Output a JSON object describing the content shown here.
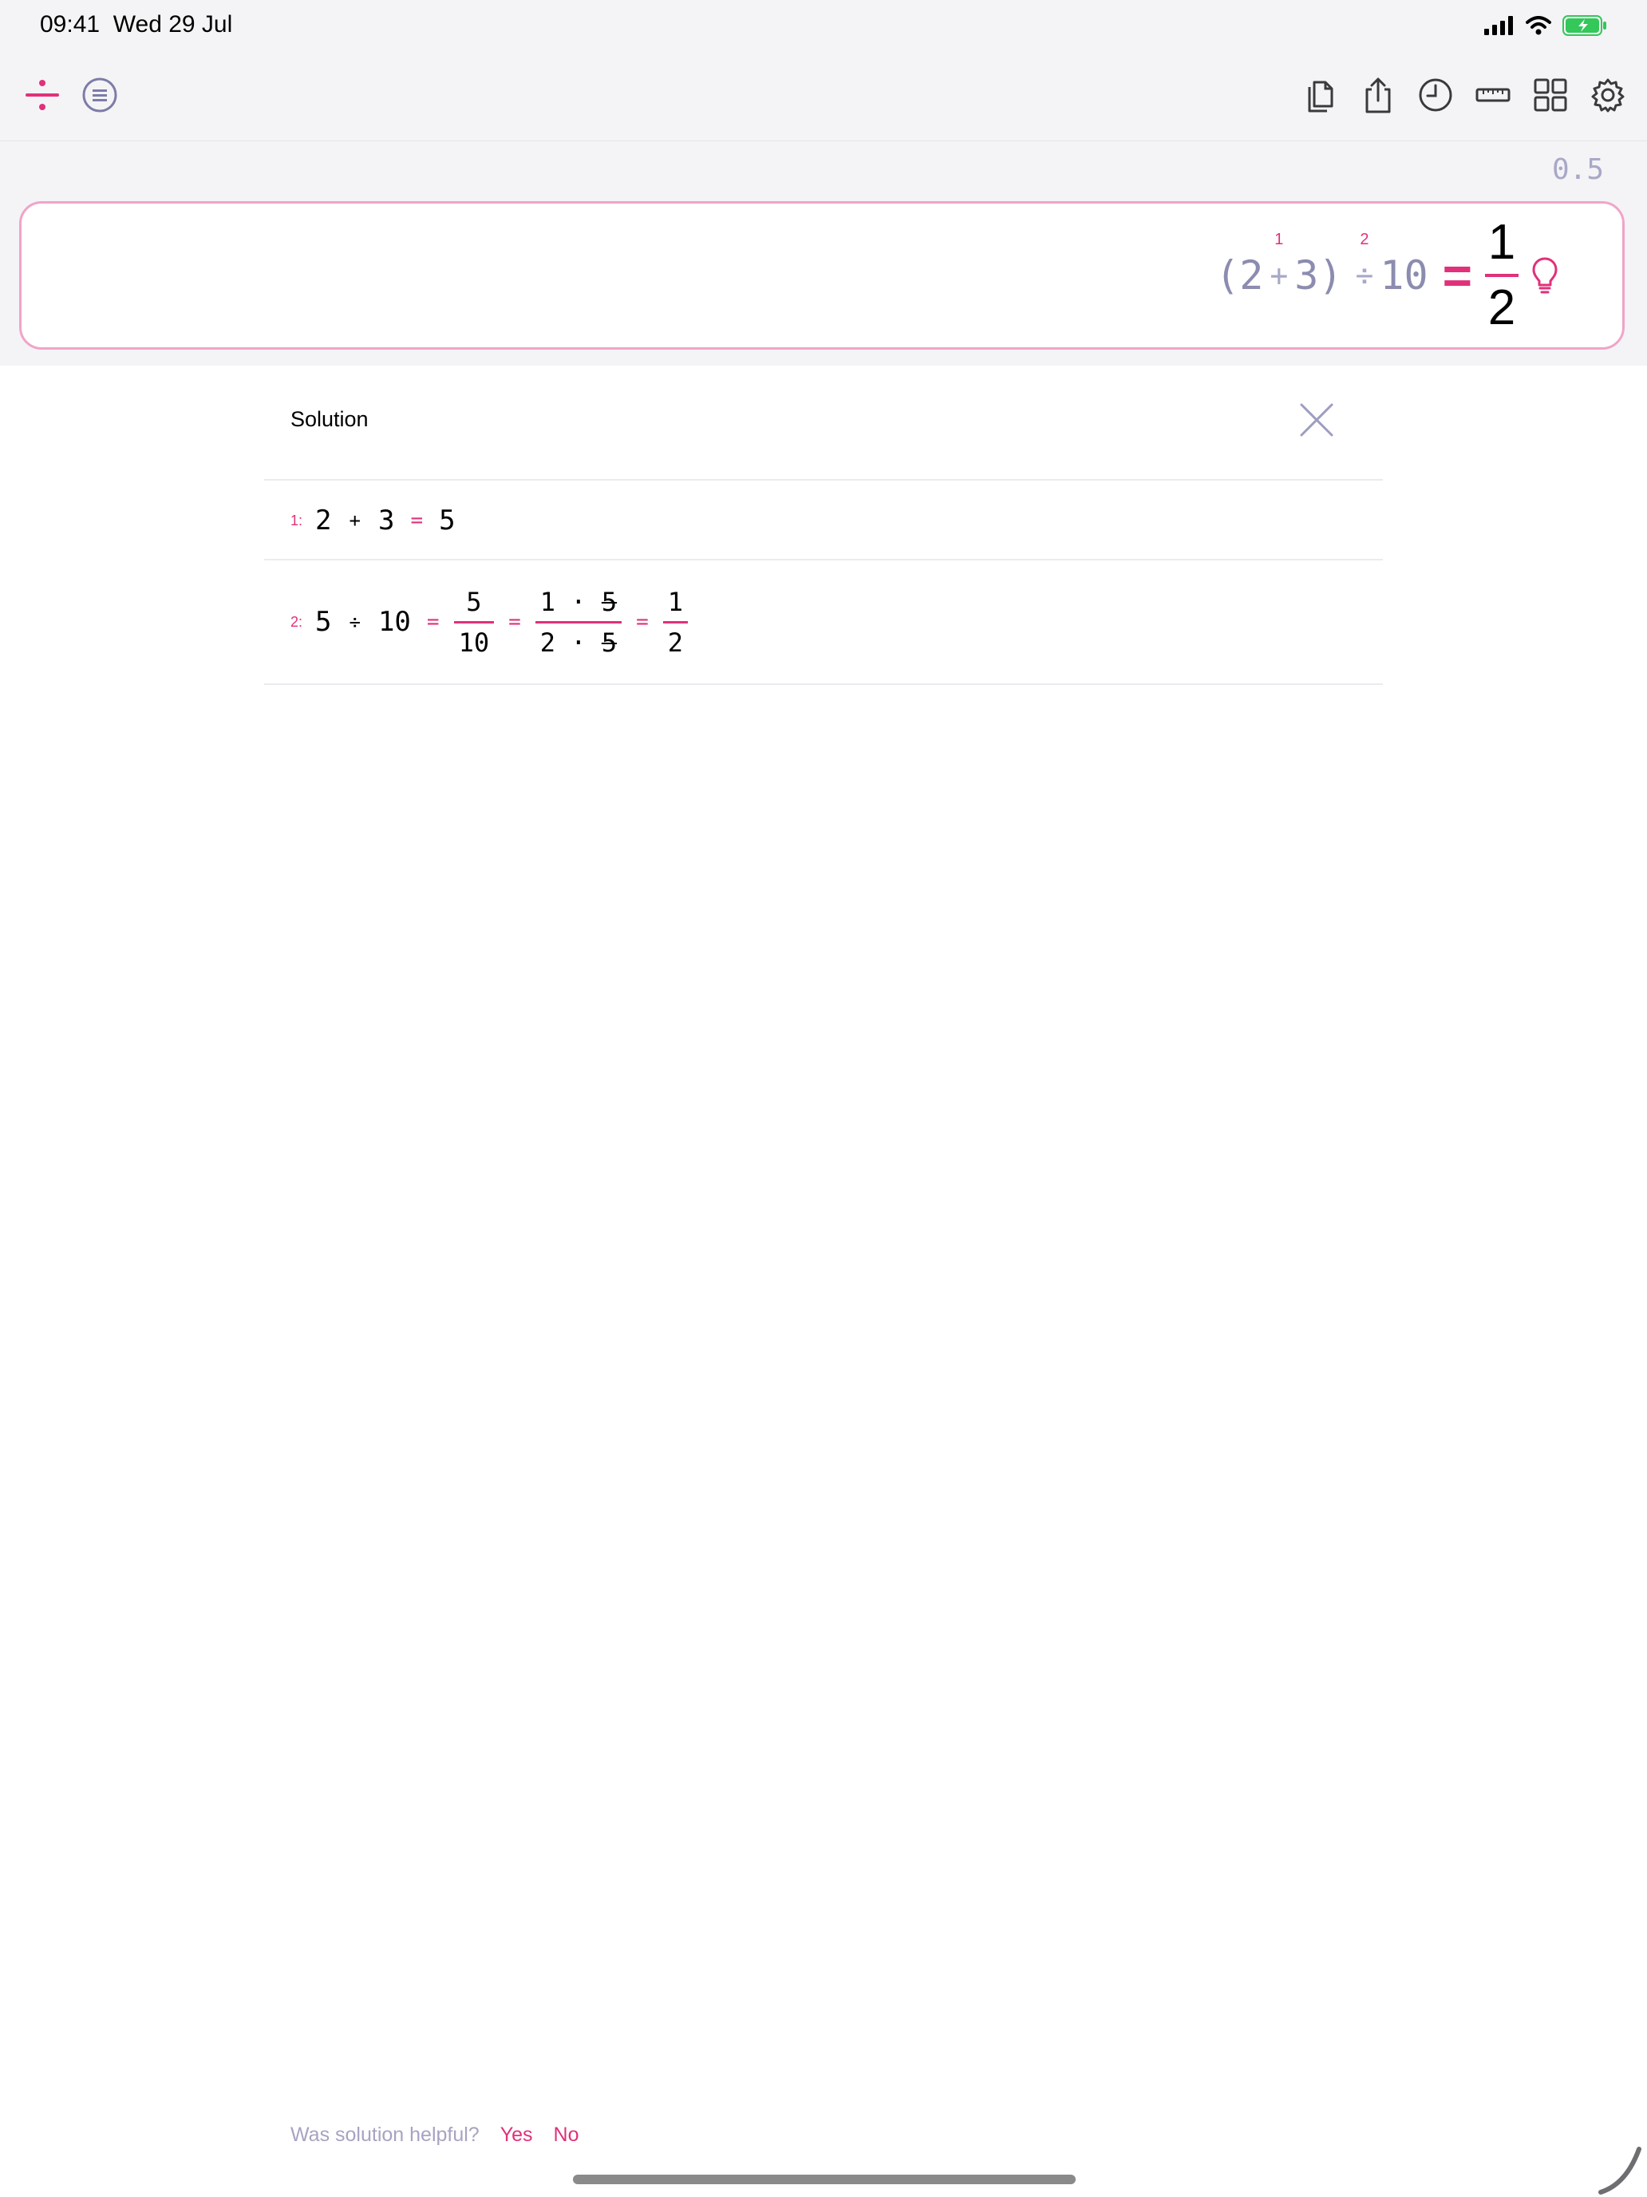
{
  "status_bar": {
    "time": "09:41",
    "date": "Wed 29 Jul"
  },
  "toolbar": {
    "left_icons": [
      "divide-icon",
      "menu-icon"
    ],
    "right_icons": [
      "copy-icon",
      "share-icon",
      "history-icon",
      "ruler-icon",
      "grid-icon",
      "settings-icon"
    ]
  },
  "decimal_result": "0.5",
  "expression": {
    "open_paren": "(",
    "a": "2",
    "op1": "+",
    "op1_step": "1",
    "b": "3",
    "close_paren": ")",
    "op2": "÷",
    "op2_step": "2",
    "c": "10",
    "equals": "=",
    "result_num": "1",
    "result_den": "2"
  },
  "solution": {
    "title": "Solution",
    "step1": {
      "label": "1:",
      "a": "2",
      "op": "+",
      "b": "3",
      "eq": "=",
      "result": "5"
    },
    "step2": {
      "label": "2:",
      "a": "5",
      "op": "÷",
      "b": "10",
      "eq1": "=",
      "frac1_num": "5",
      "frac1_den": "10",
      "eq2": "=",
      "frac2_num_a": "1",
      "frac2_dot": "·",
      "frac2_num_b": "5",
      "frac2_den_a": "2",
      "frac2_den_b": "5",
      "eq3": "=",
      "frac3_num": "1",
      "frac3_den": "2"
    }
  },
  "feedback": {
    "question": "Was solution helpful?",
    "yes": "Yes",
    "no": "No"
  },
  "colors": {
    "accent": "#e0317a",
    "muted": "#a8a8c8",
    "toolbar_bg": "#f4f4f6"
  }
}
